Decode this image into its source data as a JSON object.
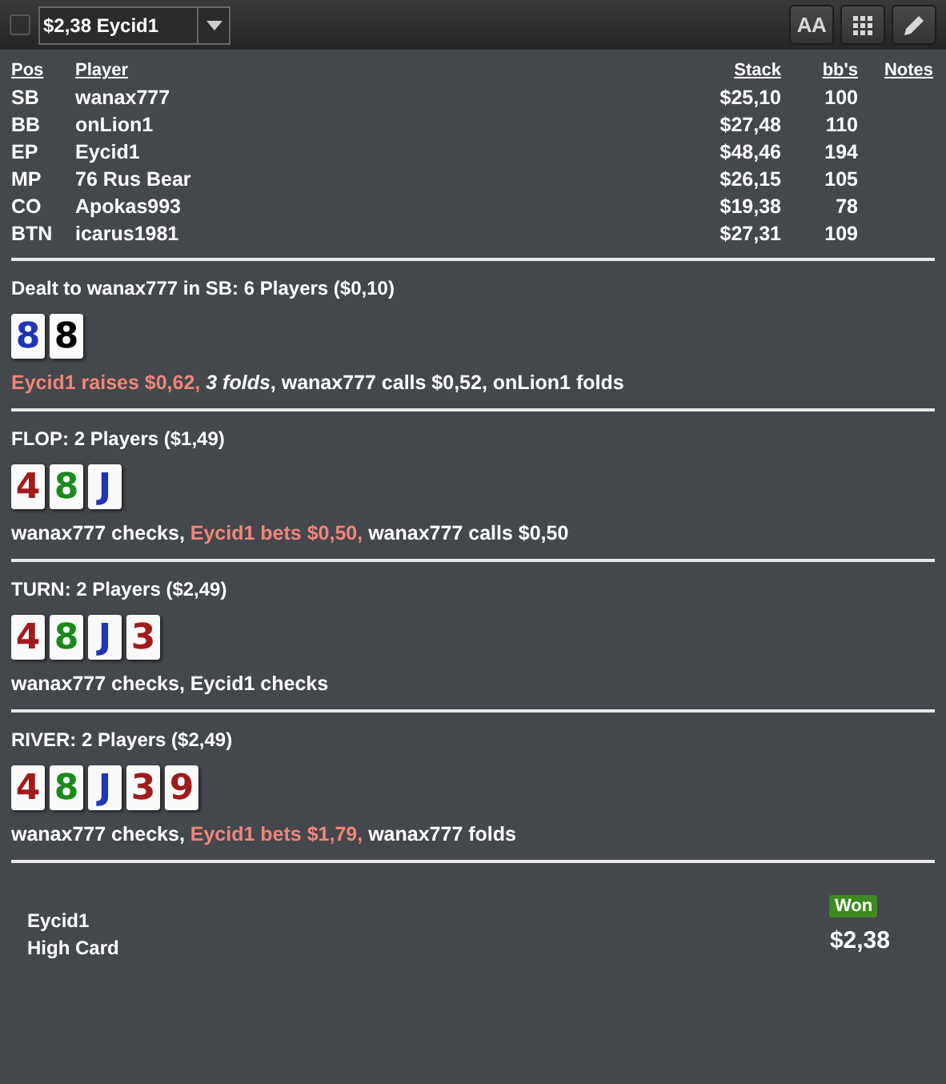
{
  "toolbar": {
    "checkbox": {
      "checked": false
    },
    "hand_select": {
      "value": "$2,38 Eycid1"
    },
    "buttons": [
      {
        "kind": "font",
        "label": "AA"
      },
      {
        "kind": "grid"
      },
      {
        "kind": "edit"
      }
    ]
  },
  "players_table": {
    "columns": [
      "Pos",
      "Player",
      "Stack",
      "bb's",
      "Notes"
    ],
    "rows": [
      [
        "SB",
        "wanax777",
        "$25,10",
        "100"
      ],
      [
        "BB",
        "onLion1",
        "$27,48",
        "110"
      ],
      [
        "EP",
        "Eycid1",
        "$48,46",
        "194"
      ],
      [
        "MP",
        "76 Rus Bear",
        "$26,15",
        "105"
      ],
      [
        "CO",
        "Apokas993",
        "$19,38",
        "78"
      ],
      [
        "BTN",
        "icarus1981",
        "$27,31",
        "109"
      ]
    ]
  },
  "streets": [
    {
      "title": "Dealt to wanax777 in SB: 6 Players ($0,10)",
      "cards": [
        {
          "rank": "8",
          "color": "#1f35b5"
        },
        {
          "rank": "8",
          "color": "#000000"
        }
      ],
      "actions": [
        {
          "text": "Eycid1 raises $0,62, ",
          "kind": "aggressive"
        },
        {
          "text": "3 folds",
          "kind": "folds"
        },
        {
          "text": ", wanax777 calls $0,52, onLion1 folds",
          "kind": "normal"
        }
      ]
    },
    {
      "title": "FLOP: 2 Players ($1,49)",
      "cards": [
        {
          "rank": "4",
          "color": "#a01c1c"
        },
        {
          "rank": "8",
          "color": "#1a8a1a"
        },
        {
          "rank": "J",
          "color": "#1f35b5"
        }
      ],
      "actions": [
        {
          "text": "wanax777 checks, ",
          "kind": "normal"
        },
        {
          "text": "Eycid1 bets $0,50, ",
          "kind": "aggressive"
        },
        {
          "text": "wanax777 calls $0,50",
          "kind": "normal"
        }
      ]
    },
    {
      "title": "TURN: 2 Players ($2,49)",
      "cards": [
        {
          "rank": "4",
          "color": "#a01c1c"
        },
        {
          "rank": "8",
          "color": "#1a8a1a"
        },
        {
          "rank": "J",
          "color": "#1f35b5"
        },
        {
          "rank": "3",
          "color": "#a01c1c"
        }
      ],
      "actions": [
        {
          "text": "wanax777 checks, Eycid1 checks",
          "kind": "normal"
        }
      ]
    },
    {
      "title": "RIVER: 2 Players ($2,49)",
      "cards": [
        {
          "rank": "4",
          "color": "#a01c1c"
        },
        {
          "rank": "8",
          "color": "#1a8a1a"
        },
        {
          "rank": "J",
          "color": "#1f35b5"
        },
        {
          "rank": "3",
          "color": "#a01c1c"
        },
        {
          "rank": "9",
          "color": "#a01c1c"
        }
      ],
      "actions": [
        {
          "text": "wanax777 checks, ",
          "kind": "normal"
        },
        {
          "text": "Eycid1 bets $1,79, ",
          "kind": "aggressive"
        },
        {
          "text": "wanax777 folds",
          "kind": "normal"
        }
      ]
    }
  ],
  "result": {
    "player": "Eycid1",
    "hand": "High Card",
    "badge": "Won",
    "amount": "$2,38"
  }
}
